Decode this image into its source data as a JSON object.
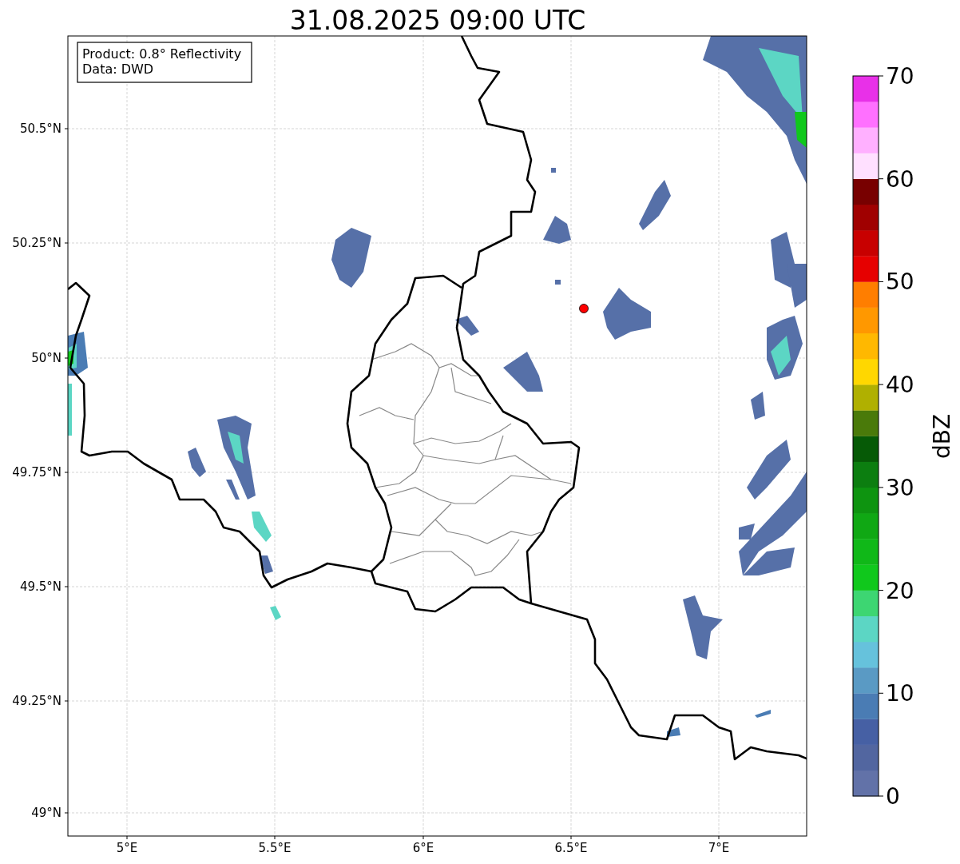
{
  "title": "31.08.2025 09:00 UTC",
  "info_box": [
    "Product: 0.8° Reflectivity",
    "Data: DWD"
  ],
  "map": {
    "x_ticks": [
      "5°E",
      "5.5°E",
      "6°E",
      "6.5°E",
      "7°E"
    ],
    "y_ticks": [
      "50.5°N",
      "50.25°N",
      "50°N",
      "49.75°N",
      "49.5°N",
      "49.25°N",
      "49°N"
    ]
  },
  "colorbar": {
    "label": "dBZ",
    "ticks": [
      "70",
      "60",
      "50",
      "40",
      "30",
      "20",
      "10",
      "0"
    ],
    "bands": [
      {
        "color": "#6272a8"
      },
      {
        "color": "#5266a0"
      },
      {
        "color": "#4660a4"
      },
      {
        "color": "#4a7cb4"
      },
      {
        "color": "#5a9ac4"
      },
      {
        "color": "#66c2dc"
      },
      {
        "color": "#5cd6c4"
      },
      {
        "color": "#3dd672"
      },
      {
        "color": "#10c81c"
      },
      {
        "color": "#10b818"
      },
      {
        "color": "#10a814"
      },
      {
        "color": "#0e9410"
      },
      {
        "color": "#0c7e10"
      },
      {
        "color": "#065a06"
      },
      {
        "color": "#4a7a0a"
      },
      {
        "color": "#b0b000"
      },
      {
        "color": "#ffd700"
      },
      {
        "color": "#ffb800"
      },
      {
        "color": "#ff9800"
      },
      {
        "color": "#ff7e00"
      },
      {
        "color": "#e60000"
      },
      {
        "color": "#c80000"
      },
      {
        "color": "#a00000"
      },
      {
        "color": "#780000"
      },
      {
        "color": "#ffe0ff"
      },
      {
        "color": "#ffb0ff"
      },
      {
        "color": "#ff70ff"
      },
      {
        "color": "#e830e8"
      }
    ]
  }
}
